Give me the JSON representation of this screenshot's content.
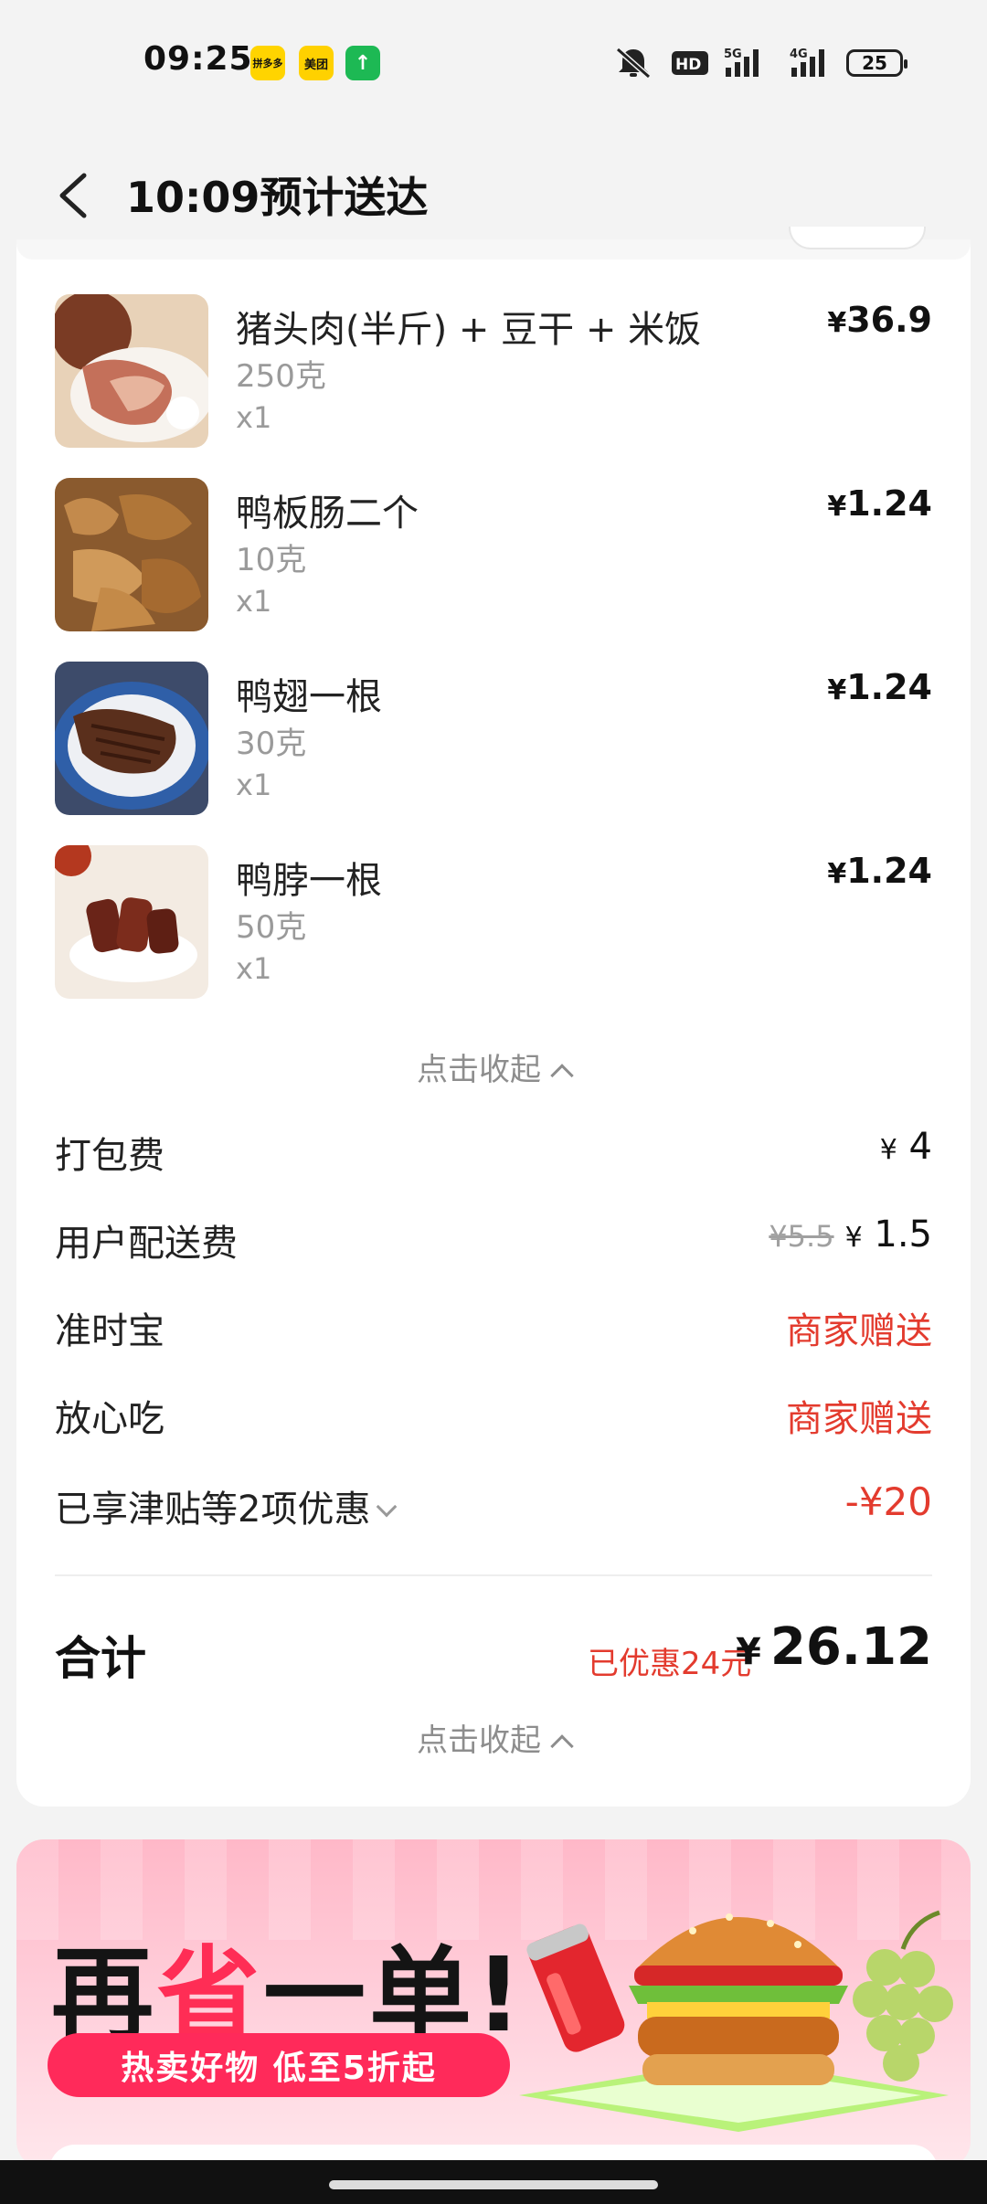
{
  "status_bar": {
    "time": "09:25",
    "apps": [
      "拼多多",
      "美团",
      "↑"
    ],
    "battery": "25",
    "icons": [
      "mute-icon",
      "hd-icon",
      "5g-signal-icon",
      "4g-signal-icon",
      "battery-icon"
    ]
  },
  "header": {
    "title": "10:09预计送达",
    "back_icon": "chevron-left-icon"
  },
  "products": [
    {
      "name": "猪头肉(半斤) + 豆干 + 米饭",
      "spec": "250克",
      "qty": "x1",
      "price": "36.9"
    },
    {
      "name": "鸭板肠二个",
      "spec": "10克",
      "qty": "x1",
      "price": "1.24"
    },
    {
      "name": "鸭翅一根",
      "spec": "30克",
      "qty": "x1",
      "price": "1.24"
    },
    {
      "name": "鸭脖一根",
      "spec": "50克",
      "qty": "x1",
      "price": "1.24"
    }
  ],
  "currency": "¥",
  "collapse_label": "点击收起",
  "fees": {
    "packing": {
      "label": "打包费",
      "value": "4"
    },
    "delivery": {
      "label": "用户配送费",
      "original": "¥5.5",
      "value": "1.5"
    },
    "ontime": {
      "label": "准时宝",
      "value": "商家赠送"
    },
    "safe": {
      "label": "放心吃",
      "value": "商家赠送"
    },
    "discount": {
      "label": "已享津贴等2项优惠",
      "value": "-¥20"
    }
  },
  "total": {
    "label": "合计",
    "saved": "已优惠24元",
    "value": "26.12"
  },
  "banner": {
    "title_part1": "再",
    "title_part2": "省",
    "title_part3": "一单!",
    "subtitle": "热卖好物 低至5折起"
  },
  "colors": {
    "accent_red": "#e33b2e",
    "banner_pink": "#ff2a5a"
  }
}
